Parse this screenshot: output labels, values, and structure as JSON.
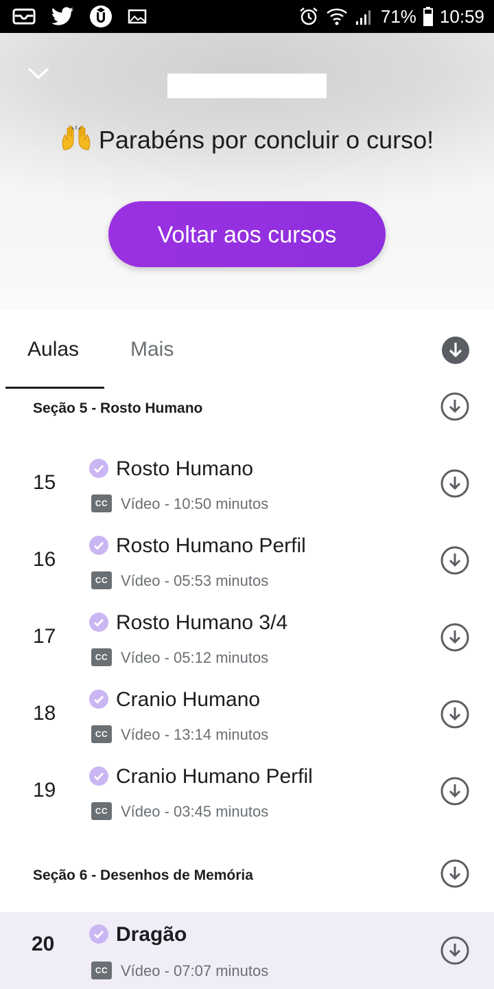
{
  "status_bar": {
    "battery": "71%",
    "time": "10:59",
    "left_icons": [
      "mail-icon",
      "twitter-icon",
      "udemy-icon",
      "image-icon"
    ],
    "right_icons": [
      "alarm-icon",
      "wifi-icon",
      "signal-icon",
      "battery-icon"
    ]
  },
  "header": {
    "congrats_text": "Parabéns por concluir o curso!",
    "back_button_label": "Voltar aos cursos",
    "accent_color": "#9b2fe0"
  },
  "tabs": [
    {
      "label": "Aulas",
      "active": true
    },
    {
      "label": "Mais",
      "active": false
    }
  ],
  "sections": [
    {
      "title": "Seção 5 - Rosto Humano",
      "lessons": [
        {
          "number": "15",
          "title": "Rosto Humano",
          "meta": "Vídeo - 10:50 minutos",
          "completed": true
        },
        {
          "number": "16",
          "title": "Rosto Humano Perfil",
          "meta": "Vídeo - 05:53 minutos",
          "completed": true
        },
        {
          "number": "17",
          "title": "Rosto Humano 3/4",
          "meta": "Vídeo - 05:12 minutos",
          "completed": true
        },
        {
          "number": "18",
          "title": "Cranio Humano",
          "meta": "Vídeo - 13:14 minutos",
          "completed": true
        },
        {
          "number": "19",
          "title": "Cranio Humano Perfil",
          "meta": "Vídeo - 03:45 minutos",
          "completed": true
        }
      ]
    },
    {
      "title": "Seção 6 - Desenhos de Memória",
      "lessons": [
        {
          "number": "20",
          "title": "Dragão",
          "meta": "Vídeo - 07:07 minutos",
          "completed": true,
          "current": true
        }
      ]
    }
  ],
  "cc_label": "CC"
}
